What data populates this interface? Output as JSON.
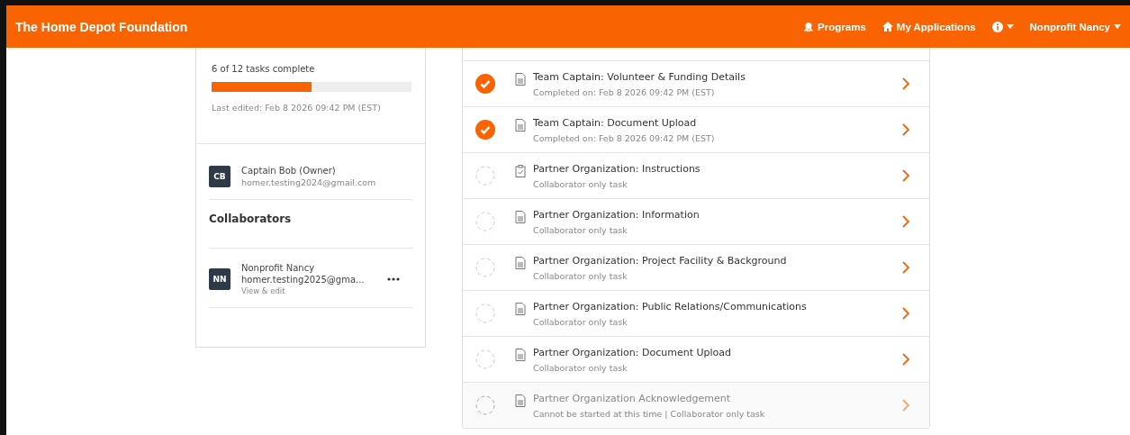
{
  "header": {
    "title": "The Home Depot Foundation",
    "nav": [
      {
        "kind": "programs",
        "label": "Programs"
      },
      {
        "kind": "home",
        "label": "My Applications"
      },
      {
        "kind": "info"
      },
      {
        "kind": "user",
        "label": "Nonprofit Nancy"
      }
    ]
  },
  "progress": {
    "label": "6 of 12 tasks complete",
    "level": 0.5,
    "last_edited": "Last edited: Feb 8 2026 09:42 PM (EST)"
  },
  "owner": {
    "initials": "CB",
    "name": "Captain Bob (Owner)",
    "email": "homer.testing2024@gmail.com"
  },
  "collaborators_heading": "Collaborators",
  "collaborators": [
    {
      "initials": "NN",
      "name": "Nonprofit Nancy",
      "email": "homer.testing2025@gma...",
      "access": "View & edit"
    }
  ],
  "tasks": [
    {
      "title": "Team Captain: Volunteer & Funding Details",
      "subtitle": "Completed on: Feb 8 2026 09:42 PM (EST)",
      "kind": "document",
      "completed": true,
      "disabled": false
    },
    {
      "title": "Team Captain: Document Upload",
      "subtitle": "Completed on: Feb 8 2026 09:42 PM (EST)",
      "kind": "document",
      "completed": true,
      "disabled": false
    },
    {
      "title": "Partner Organization: Instructions",
      "subtitle": "Collaborator only task",
      "kind": "checklist",
      "completed": false,
      "disabled": false
    },
    {
      "title": "Partner Organization: Information",
      "subtitle": "Collaborator only task",
      "kind": "document",
      "completed": false,
      "disabled": false
    },
    {
      "title": "Partner Organization: Project Facility & Background",
      "subtitle": "Collaborator only task",
      "kind": "document",
      "completed": false,
      "disabled": false
    },
    {
      "title": "Partner Organization: Public Relations/Communications",
      "subtitle": "Collaborator only task",
      "kind": "document",
      "completed": false,
      "disabled": false
    },
    {
      "title": "Partner Organization: Document Upload",
      "subtitle": "Collaborator only task",
      "kind": "document",
      "completed": false,
      "disabled": false
    },
    {
      "title": "Partner Organization Acknowledgement",
      "subtitle": "Cannot be started at this time | Collaborator only task",
      "kind": "document",
      "completed": false,
      "disabled": true
    }
  ]
}
